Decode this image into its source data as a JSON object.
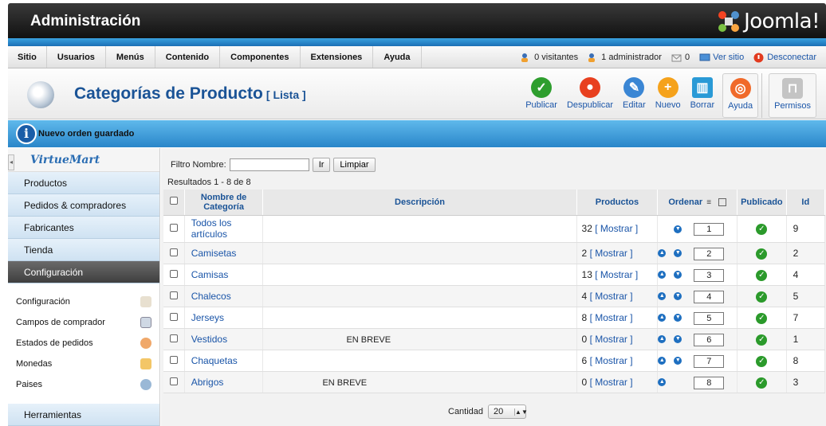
{
  "header": {
    "title": "Administración",
    "logo_text": "Joomla!"
  },
  "menu": {
    "items": [
      "Sitio",
      "Usuarios",
      "Menús",
      "Contenido",
      "Componentes",
      "Extensiones",
      "Ayuda"
    ]
  },
  "status": {
    "visitors": "0 visitantes",
    "admins": "1 administrador",
    "messages": "0",
    "view_site": "Ver sitio",
    "logout": "Desconectar"
  },
  "toolbar": {
    "title": "Categorías de Producto",
    "subtitle": "[ Lista ]",
    "buttons": [
      "Publicar",
      "Despublicar",
      "Editar",
      "Nuevo",
      "Borrar",
      "Ayuda",
      "Permisos"
    ]
  },
  "message": {
    "text": "Nuevo orden guardado",
    "icon_glyph": "i"
  },
  "sidebar": {
    "logo": "VirtueMart",
    "nav": [
      "Productos",
      "Pedidos & compradores",
      "Fabricantes",
      "Tienda",
      "Configuración"
    ],
    "sub": [
      {
        "label": "Configuración",
        "icon": "tools-icon"
      },
      {
        "label": "Campos de comprador",
        "icon": "fields-icon"
      },
      {
        "label": "Estados de pedidos",
        "icon": "status-icon"
      },
      {
        "label": "Monedas",
        "icon": "coins-icon"
      },
      {
        "label": "Paises",
        "icon": "globe-icon"
      }
    ],
    "tools": "Herramientas"
  },
  "filter": {
    "label": "Filtro Nombre:",
    "value": "",
    "go": "Ir",
    "reset": "Limpiar",
    "results": "Resultados 1 - 8 de 8"
  },
  "table": {
    "headers": {
      "name": "Nombre de Categoría",
      "desc": "Descripción",
      "products": "Productos",
      "order": "Ordenar",
      "published": "Publicado",
      "id": "Id"
    },
    "rows": [
      {
        "name": "Todos los artículos",
        "desc": "",
        "count": "32",
        "show": "[ Mostrar ]",
        "order": "1",
        "id": "9"
      },
      {
        "name": "Camisetas",
        "desc": "",
        "count": "2",
        "show": "[ Mostrar ]",
        "order": "2",
        "id": "2"
      },
      {
        "name": "Camisas",
        "desc": "",
        "count": "13",
        "show": "[ Mostrar ]",
        "order": "3",
        "id": "4"
      },
      {
        "name": "Chalecos",
        "desc": "",
        "count": "4",
        "show": "[ Mostrar ]",
        "order": "4",
        "id": "5"
      },
      {
        "name": "Jerseys",
        "desc": "",
        "count": "8",
        "show": "[ Mostrar ]",
        "order": "5",
        "id": "7"
      },
      {
        "name": "Vestidos",
        "desc": "EN BREVE",
        "count": "0",
        "show": "[ Mostrar ]",
        "order": "6",
        "id": "1"
      },
      {
        "name": "Chaquetas",
        "desc": "",
        "count": "6",
        "show": "[ Mostrar ]",
        "order": "7",
        "id": "8"
      },
      {
        "name": "Abrigos",
        "desc": "EN BREVE",
        "count": "0",
        "show": "[ Mostrar ]",
        "order": "8",
        "id": "3"
      }
    ]
  },
  "pager": {
    "label": "Cantidad",
    "limit": "20"
  },
  "colors": {
    "accent": "#1a5396",
    "link": "#1a55a8",
    "info_bar": "#3fa0de",
    "publish_green": "#2b9a2b"
  }
}
